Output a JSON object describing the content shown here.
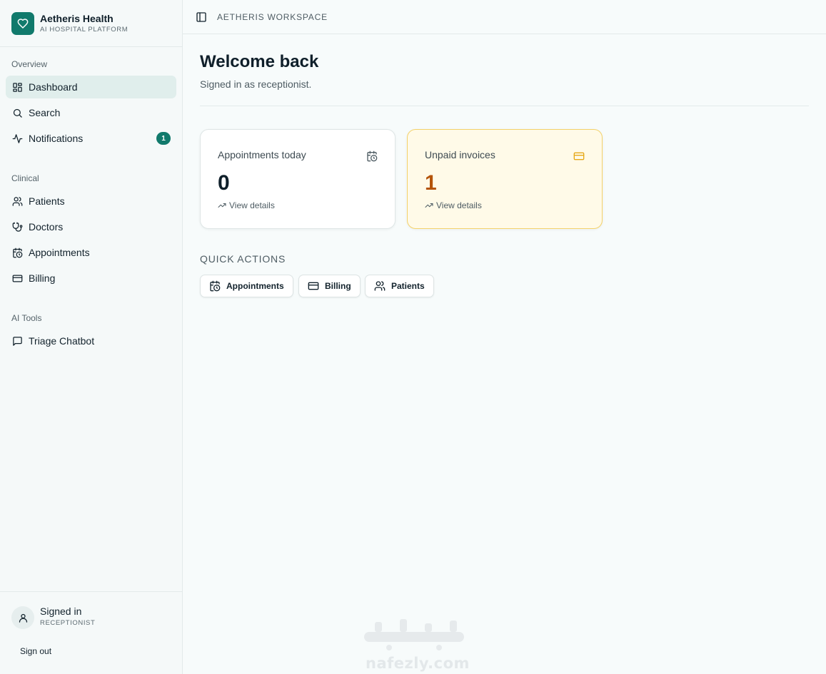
{
  "brand": {
    "name": "Aetheris Health",
    "subtitle": "AI HOSPITAL PLATFORM",
    "color": "#117a6c"
  },
  "sidebar": {
    "sections": [
      {
        "title": "Overview",
        "items": [
          {
            "label": "Dashboard",
            "icon": "grid-icon",
            "active": true
          },
          {
            "label": "Search",
            "icon": "search-icon"
          },
          {
            "label": "Notifications",
            "icon": "activity-icon",
            "badge": "1"
          }
        ]
      },
      {
        "title": "Clinical",
        "items": [
          {
            "label": "Patients",
            "icon": "users-icon"
          },
          {
            "label": "Doctors",
            "icon": "stethoscope-icon"
          },
          {
            "label": "Appointments",
            "icon": "calendar-clock-icon"
          },
          {
            "label": "Billing",
            "icon": "credit-card-icon"
          }
        ]
      },
      {
        "title": "AI Tools",
        "items": [
          {
            "label": "Triage Chatbot",
            "icon": "message-square-icon"
          }
        ]
      }
    ],
    "footer": {
      "status": "Signed in",
      "role": "RECEPTIONIST",
      "signout": "Sign out"
    }
  },
  "topbar": {
    "workspace": "AETHERIS WORKSPACE"
  },
  "main": {
    "title": "Welcome back",
    "subtitle": "Signed in as receptionist.",
    "cards": [
      {
        "title": "Appointments today",
        "value": "0",
        "link": "View details",
        "icon": "calendar-clock-icon"
      },
      {
        "title": "Unpaid invoices",
        "value": "1",
        "link": "View details",
        "icon": "credit-card-icon",
        "accent": "#e6a817"
      }
    ],
    "quick_actions": {
      "title": "QUICK ACTIONS",
      "buttons": [
        {
          "label": "Appointments",
          "icon": "calendar-clock-icon"
        },
        {
          "label": "Billing",
          "icon": "credit-card-icon"
        },
        {
          "label": "Patients",
          "icon": "users-icon"
        }
      ]
    }
  },
  "watermark": {
    "arabic": "نفذلي",
    "latin": "nafezly.com"
  }
}
